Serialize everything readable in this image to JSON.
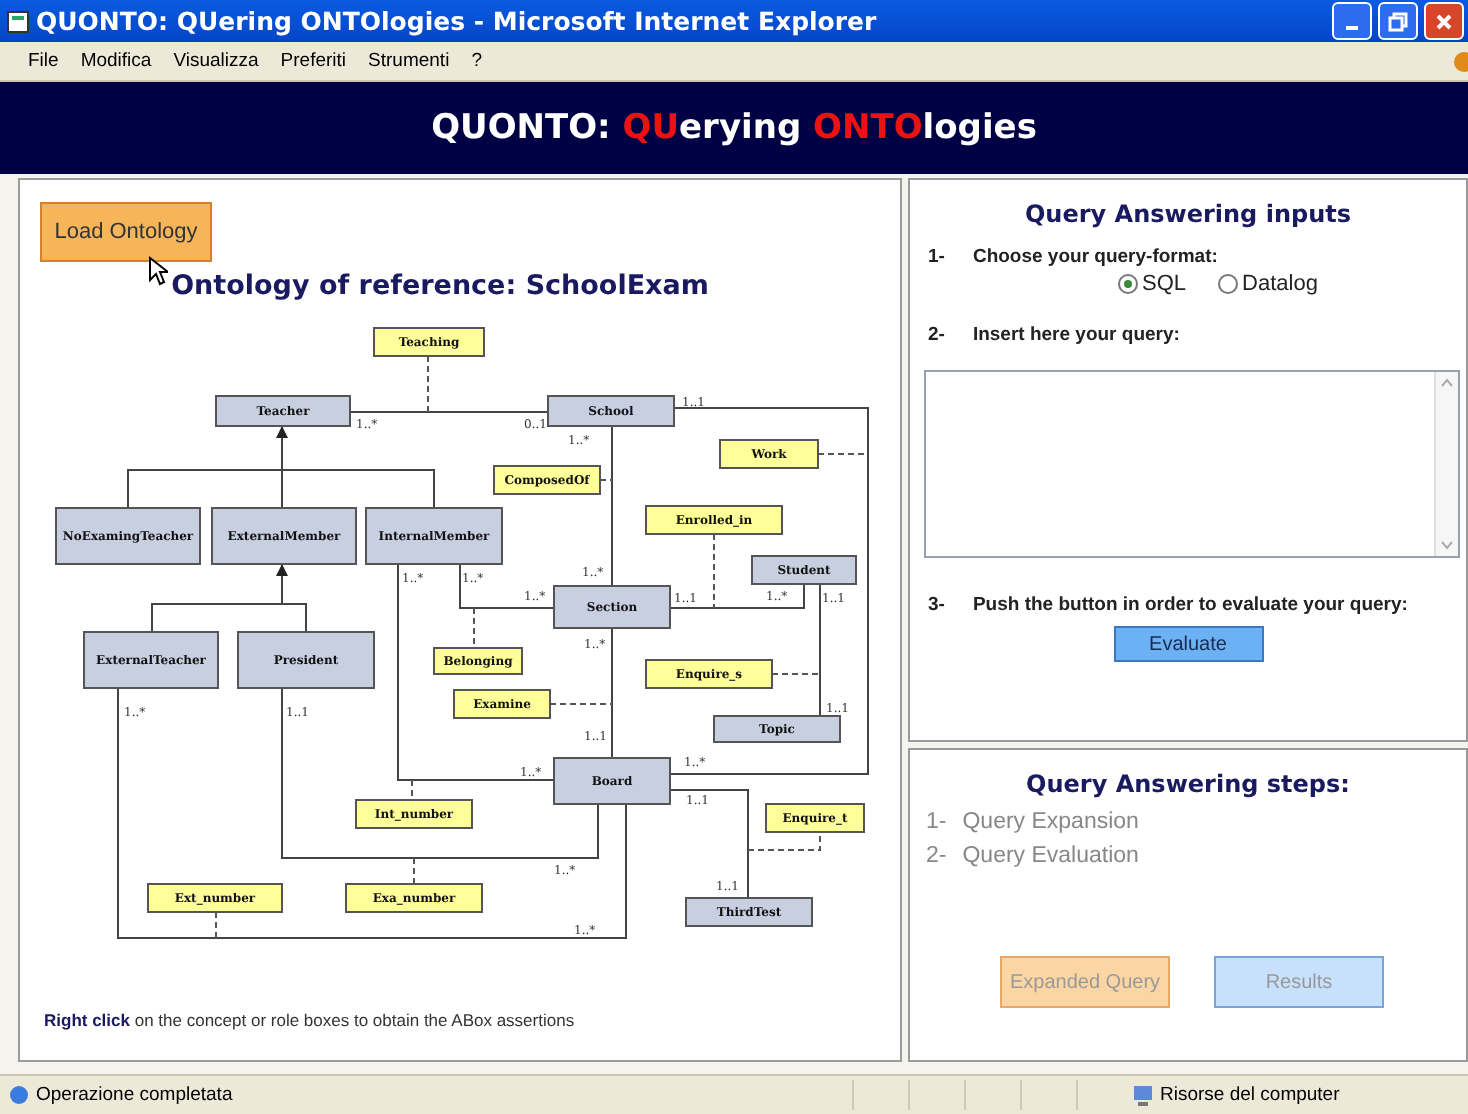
{
  "window": {
    "title": "QUONTO: QUering ONTOlogies - Microsoft Internet Explorer"
  },
  "menu": [
    "File",
    "Modifica",
    "Visualizza",
    "Preferiti",
    "Strumenti",
    "?"
  ],
  "header": {
    "parts": [
      {
        "text": "QUONTO: ",
        "highlight": false
      },
      {
        "text": "QU",
        "highlight": true
      },
      {
        "text": "erying ",
        "highlight": false
      },
      {
        "text": "ONTO",
        "highlight": true
      },
      {
        "text": "logies",
        "highlight": false
      }
    ]
  },
  "ontology_panel": {
    "load_button": "Load Ontology",
    "title": "Ontology of reference: SchoolExam",
    "nodes": [
      {
        "label": "Teaching",
        "kind": "role"
      },
      {
        "label": "Teacher",
        "kind": "concept"
      },
      {
        "label": "School",
        "kind": "concept"
      },
      {
        "label": "Work",
        "kind": "role"
      },
      {
        "label": "ComposedOf",
        "kind": "role"
      },
      {
        "label": "Enrolled_in",
        "kind": "role"
      },
      {
        "label": "NoExamingTeacher",
        "kind": "concept"
      },
      {
        "label": "ExternalMember",
        "kind": "concept"
      },
      {
        "label": "InternalMember",
        "kind": "concept"
      },
      {
        "label": "Student",
        "kind": "concept"
      },
      {
        "label": "Section",
        "kind": "concept"
      },
      {
        "label": "ExternalTeacher",
        "kind": "concept"
      },
      {
        "label": "President",
        "kind": "concept"
      },
      {
        "label": "Belonging",
        "kind": "role"
      },
      {
        "label": "Examine",
        "kind": "role"
      },
      {
        "label": "Enquire_s",
        "kind": "role"
      },
      {
        "label": "Topic",
        "kind": "concept"
      },
      {
        "label": "Board",
        "kind": "concept"
      },
      {
        "label": "Int_number",
        "kind": "role"
      },
      {
        "label": "Enquire_t",
        "kind": "role"
      },
      {
        "label": "Ext_number",
        "kind": "role"
      },
      {
        "label": "Exa_number",
        "kind": "role"
      },
      {
        "label": "ThirdTest",
        "kind": "concept"
      }
    ],
    "multiplicities": [
      "1..*",
      "0..1",
      "1..1",
      "1..*",
      "1..*",
      "1..*",
      "1..*",
      "1..*",
      "1..1",
      "1..*",
      "1..1",
      "1..*",
      "1..*",
      "1..1",
      "1..1",
      "1..1",
      "1..*",
      "1..*",
      "1..1",
      "1..*",
      "1..1",
      "1..*"
    ],
    "note": "**Right click** on the concept or role boxes to obtain the ABox assertions"
  },
  "inputs_panel": {
    "title": "Query Answering inputs",
    "steps": [
      {
        "number": "1-",
        "text": "Choose your query-format:"
      },
      {
        "number": "2-",
        "text": "Insert here your query:"
      },
      {
        "number": "3-",
        "text": "Push the button in order to evaluate your query:"
      }
    ],
    "formats": [
      {
        "label": "SQL",
        "selected": true
      },
      {
        "label": "Datalog",
        "selected": false
      }
    ],
    "evaluate_button": "Evaluate"
  },
  "steps_panel": {
    "title": "Query Answering steps:",
    "steps": [
      {
        "number": "1-",
        "text": "Query Expansion"
      },
      {
        "number": "2-",
        "text": "Query Evaluation"
      }
    ],
    "buttons": [
      {
        "label": "Expanded Query",
        "kind": "expand",
        "disabled": true
      },
      {
        "label": "Results",
        "kind": "results",
        "disabled": true
      }
    ]
  },
  "status_bar": {
    "message": "Operazione completata",
    "zone": "Risorse del computer"
  }
}
